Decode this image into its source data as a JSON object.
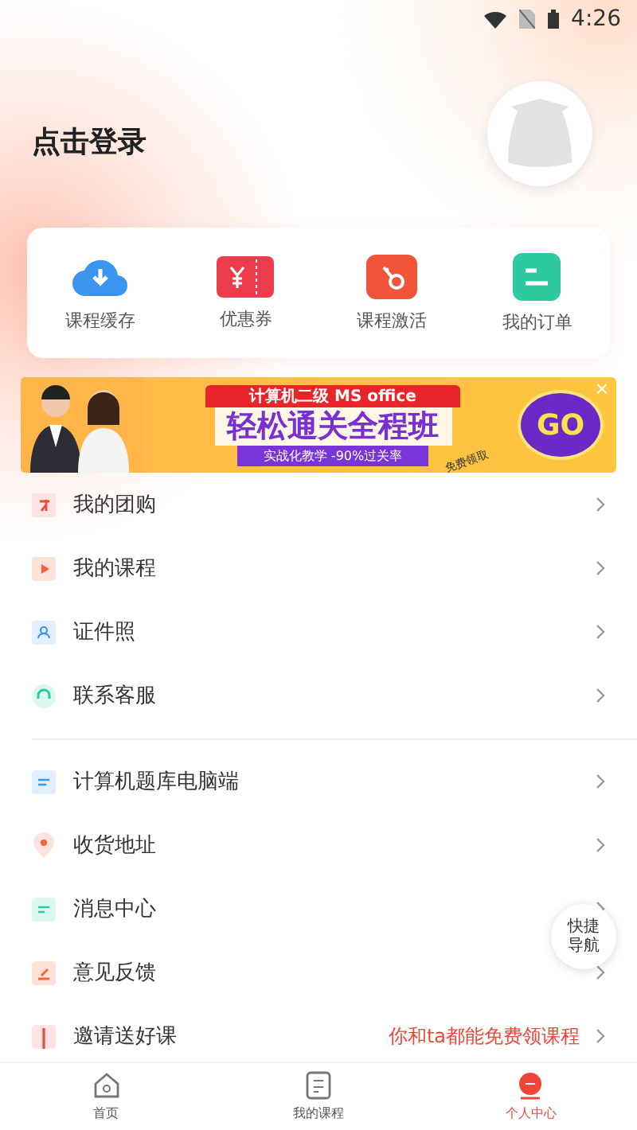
{
  "status_bar": {
    "time": "4:26"
  },
  "header": {
    "login": "点击登录"
  },
  "shortcuts": [
    {
      "label": "课程缓存"
    },
    {
      "label": "优惠券"
    },
    {
      "label": "课程激活"
    },
    {
      "label": "我的订单"
    }
  ],
  "banner": {
    "top": "计算机二级 MS office",
    "headline": "轻松通关全程班",
    "sub": "实战化教学 -90%过关率",
    "go": "GO",
    "tag": "免费领取",
    "close": "×"
  },
  "menu_groups": [
    {
      "items": [
        {
          "label": "我的团购"
        },
        {
          "label": "我的课程"
        },
        {
          "label": "证件照"
        },
        {
          "label": "联系客服"
        }
      ]
    },
    {
      "items": [
        {
          "label": "计算机题库电脑端"
        },
        {
          "label": "收货地址"
        },
        {
          "label": "消息中心"
        },
        {
          "label": "意见反馈"
        },
        {
          "label": "邀请送好课",
          "note": "你和ta都能免费领课程"
        }
      ]
    }
  ],
  "quick_nav": "快捷导航",
  "tabs": [
    {
      "label": "首页",
      "selected": false
    },
    {
      "label": "我的课程",
      "selected": false
    },
    {
      "label": "个人中心",
      "selected": true
    }
  ]
}
